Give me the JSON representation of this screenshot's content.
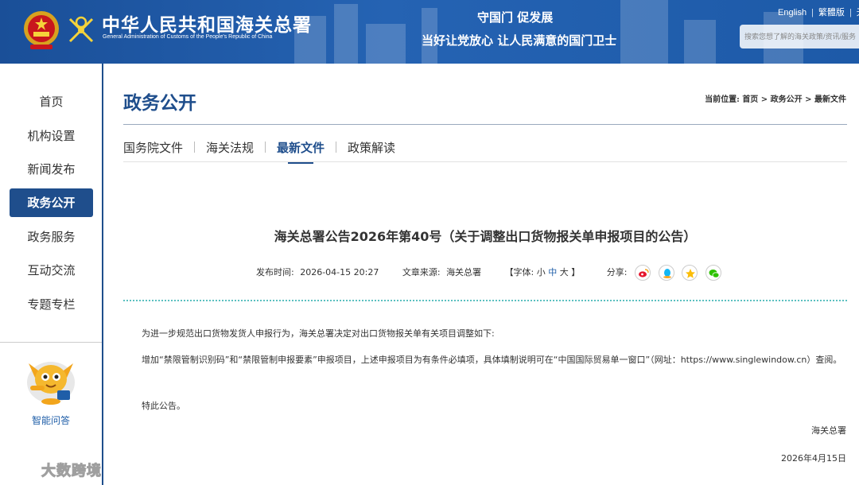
{
  "header": {
    "brand_cn": "中华人民共和国海关总署",
    "brand_en": "General Administration of Customs of the People's Republic of China",
    "slogan_line1": "守国门   促发展",
    "slogan_line2": "当好让党放心   让人民满意的国门卫士",
    "lang_english": "English",
    "lang_traditional": "繁體版",
    "lang_more": "无",
    "search_placeholder": "搜索您想了解的海关政策/资讯/服务"
  },
  "sidebar": {
    "items": [
      {
        "label": "首页",
        "active": false
      },
      {
        "label": "机构设置",
        "active": false
      },
      {
        "label": "新闻发布",
        "active": false
      },
      {
        "label": "政务公开",
        "active": true
      },
      {
        "label": "政务服务",
        "active": false
      },
      {
        "label": "互动交流",
        "active": false
      },
      {
        "label": "专题专栏",
        "active": false
      }
    ],
    "ai_assistant_label": "智能问答"
  },
  "main": {
    "page_title": "政务公开",
    "breadcrumb": {
      "prefix": "当前位置:",
      "items": [
        "首页",
        "政务公开",
        "最新文件"
      ],
      "separator": " > "
    },
    "tabs": [
      {
        "label": "国务院文件",
        "active": false
      },
      {
        "label": "海关法规",
        "active": false
      },
      {
        "label": "最新文件",
        "active": true
      },
      {
        "label": "政策解读",
        "active": false
      }
    ],
    "article": {
      "title": "海关总署公告2026年第40号（关于调整出口货物报关单申报项目的公告）",
      "publish_time_label": "发布时间:",
      "publish_time": "2026-04-15 20:27",
      "source_label": "文章来源:",
      "source": "海关总署",
      "font_size_label": "【字体:",
      "font_small": "小",
      "font_medium": "中",
      "font_large": "大",
      "font_size_close": "】",
      "share_label": "分享:",
      "share_icons": [
        "weibo-icon",
        "qq-icon",
        "qzone-icon",
        "wechat-icon"
      ],
      "paragraph1": "为进一步规范出口货物发货人申报行为，海关总署决定对出口货物报关单有关项目调整如下:",
      "paragraph2": "增加“禁限管制识别码”和“禁限管制申报要素”申报项目，上述申报项目为有条件必填项，具体填制说明可在“中国国际贸易单一窗口”（网址：https://www.singlewindow.cn）查阅。",
      "paragraph3": "特此公告。",
      "signature_org": "海关总署",
      "signature_date": "2026年4月15日"
    }
  },
  "watermark_text": "大数跨境",
  "colors": {
    "header_blue": "#1a4f98",
    "nav_active": "#1f4e8c",
    "title_blue": "#1f4e8c",
    "dotted_rule": "#5bc0c0"
  }
}
